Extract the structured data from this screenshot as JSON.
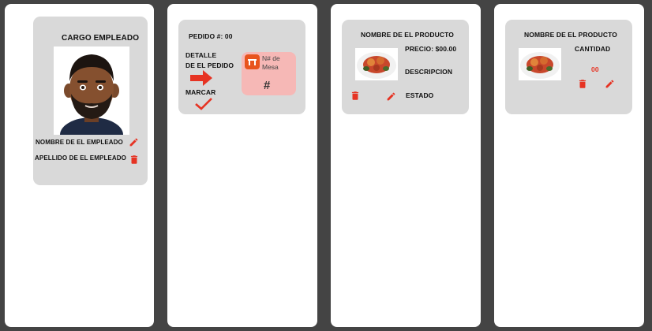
{
  "colors": {
    "background": "#444444",
    "panel": "#ffffff",
    "card": "#d9d9d9",
    "accent": "#e63323",
    "table_badge": "#f6b8b6"
  },
  "employee_card": {
    "title": "CARGO EMPLEADO",
    "avatar_icon": "employee-avatar",
    "name_label": "NOMBRE DE EL EMPLEADO",
    "lastname_label": "APELLIDO DE EL EMPLEADO",
    "edit_icon": "pencil-icon",
    "delete_icon": "trash-icon"
  },
  "order_card": {
    "order_label": "PEDIDO #: 00",
    "detail_label_line1": "DETALLE",
    "detail_label_line2": "DE EL PEDIDO",
    "mark_label": "MARCAR",
    "table_label_line1": "N# de",
    "table_label_line2": "Mesa",
    "table_symbol": "#",
    "arrow_icon": "arrow-right-icon",
    "check_icon": "check-icon",
    "table_icon": "table-icon"
  },
  "product_card": {
    "title": "NOMBRE DE EL PRODUCTO",
    "price_label": "PRECIO: $00.00",
    "description_label": "DESCRIPCION",
    "status_label": "ESTADO",
    "image_icon": "food-plate-image"
  },
  "order_item_card": {
    "title": "NOMBRE DE EL PRODUCTO",
    "quantity_label": "CANTIDAD",
    "quantity_value": "00",
    "image_icon": "food-plate-image"
  }
}
